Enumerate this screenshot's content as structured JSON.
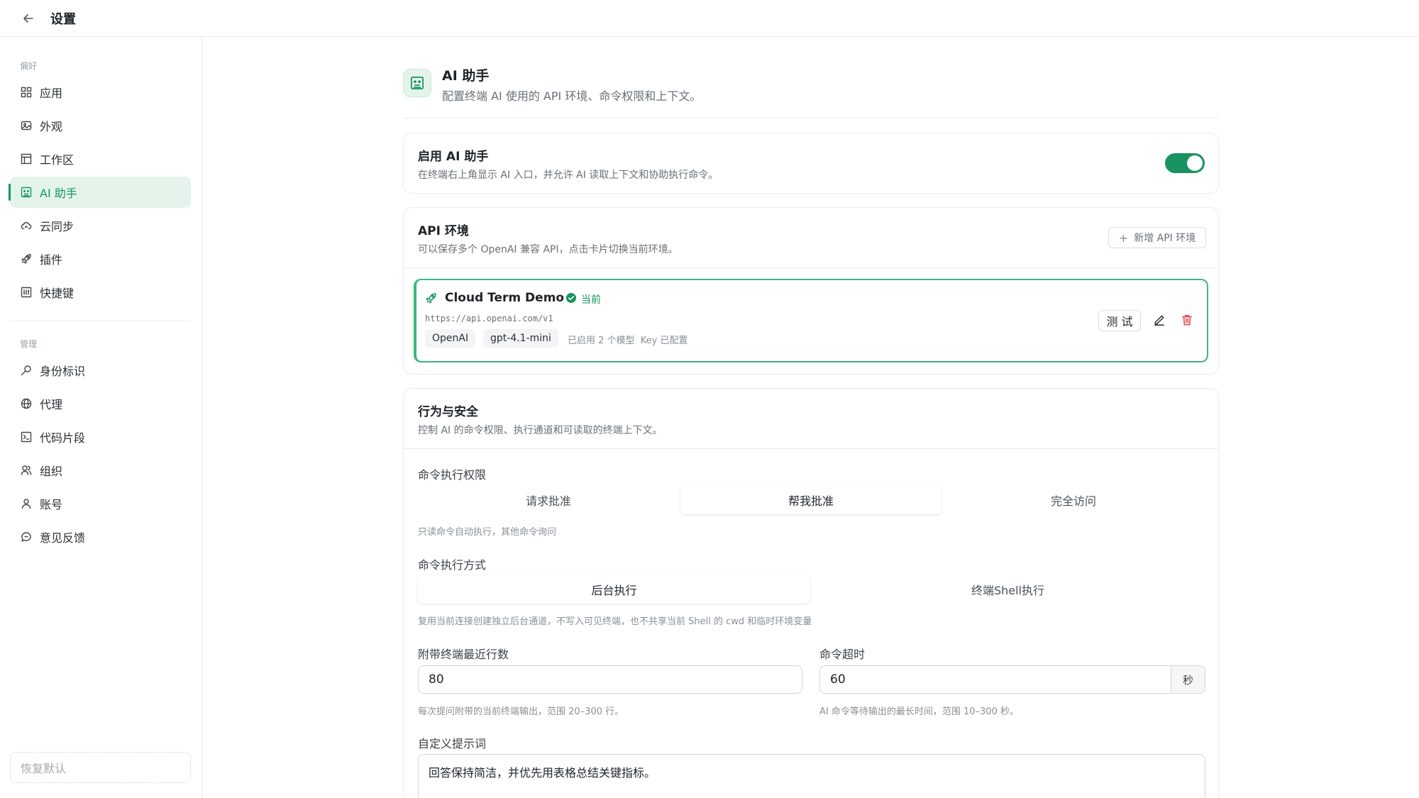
{
  "topbar": {
    "title": "设置",
    "back_icon": "arrow-left-icon"
  },
  "sidebar": {
    "section_preferences": "偏好",
    "section_manage": "管理",
    "preferences_items": [
      {
        "label": "应用",
        "icon": "grid-icon"
      },
      {
        "label": "外观",
        "icon": "image-icon"
      },
      {
        "label": "工作区",
        "icon": "layout-icon"
      },
      {
        "label": "AI 助手",
        "icon": "bot-icon",
        "active": true
      },
      {
        "label": "云同步",
        "icon": "cloud-sync-icon"
      },
      {
        "label": "插件",
        "icon": "rocket-icon"
      },
      {
        "label": "快捷键",
        "icon": "keyboard-icon"
      }
    ],
    "manage_items": [
      {
        "label": "身份标识",
        "icon": "key-icon"
      },
      {
        "label": "代理",
        "icon": "globe-icon"
      },
      {
        "label": "代码片段",
        "icon": "terminal-icon"
      },
      {
        "label": "组织",
        "icon": "users-icon"
      },
      {
        "label": "账号",
        "icon": "user-icon"
      },
      {
        "label": "意见反馈",
        "icon": "chat-icon"
      }
    ],
    "reset_label": "恢复默认"
  },
  "page": {
    "title": "AI 助手",
    "description": "配置终端 AI 使用的 API 环境、命令权限和上下文。"
  },
  "enable_card": {
    "title": "启用 AI 助手",
    "description": "在终端右上角显示 AI 入口，并允许 AI 读取上下文和协助执行命令。",
    "enabled": true
  },
  "api_card": {
    "title": "API 环境",
    "description": "可以保存多个 OpenAI 兼容 API，点击卡片切换当前环境。",
    "add_label": "新增 API 环境",
    "environment": {
      "name": "Cloud Term Demo",
      "status": "当前",
      "url": "https://api.openai.com/v1",
      "provider": "OpenAI",
      "model": "gpt-4.1-mini",
      "meta": "已启用 2 个模型  Key 已配置",
      "test_label": "测 试"
    }
  },
  "behavior_card": {
    "title": "行为与安全",
    "description": "控制 AI 的命令权限、执行通道和可读取的终端上下文。",
    "permission": {
      "label": "命令执行权限",
      "options": [
        "请求批准",
        "帮我批准",
        "完全访问"
      ],
      "selected": "帮我批准",
      "hint": "只读命令自动执行，其他命令询问"
    },
    "exec_mode": {
      "label": "命令执行方式",
      "options": [
        "后台执行",
        "终端Shell执行"
      ],
      "selected": "后台执行",
      "hint": "复用当前连接创建独立后台通道，不写入可见终端，也不共享当前 Shell 的 cwd 和临时环境变量"
    },
    "recent_lines": {
      "label": "附带终端最近行数",
      "value": "80",
      "hint": "每次提问附带的当前终端输出，范围 20–300 行。"
    },
    "timeout": {
      "label": "命令超时",
      "value": "60",
      "suffix": "秒",
      "hint": "AI 命令等待输出的最长时间，范围 10–300 秒。"
    },
    "custom_prompt": {
      "label": "自定义提示词",
      "value": "回答保持简洁，并优先用表格总结关键指标。"
    }
  },
  "colors": {
    "accent": "#17945f",
    "accent_bg": "#e4f4ea",
    "danger": "#e5484d"
  }
}
